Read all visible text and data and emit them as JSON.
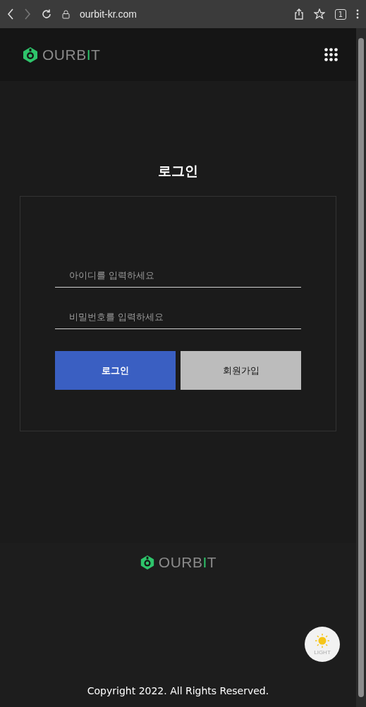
{
  "browser": {
    "url": "ourbit-kr.com",
    "tab_count": "1"
  },
  "header": {
    "logo": [
      {
        "text": "OURB",
        "accent": false
      },
      {
        "text": "I",
        "accent": true
      },
      {
        "text": "T",
        "accent": false
      }
    ]
  },
  "login": {
    "title": "로그인",
    "fields": [
      {
        "placeholder": "아이디를 입력하세요"
      },
      {
        "placeholder": "비밀번호를 입력하세요"
      }
    ],
    "buttons": [
      {
        "label": "로그인",
        "kind": "primary"
      },
      {
        "label": "회원가입",
        "kind": "secondary"
      }
    ]
  },
  "footer": {
    "logo": [
      {
        "text": "OURB",
        "accent": false
      },
      {
        "text": "I",
        "accent": true
      },
      {
        "text": "T",
        "accent": false
      }
    ],
    "copyright": "Copyright 2022. All Rights Reserved."
  },
  "theme_toggle": {
    "label": "LIGHT"
  }
}
